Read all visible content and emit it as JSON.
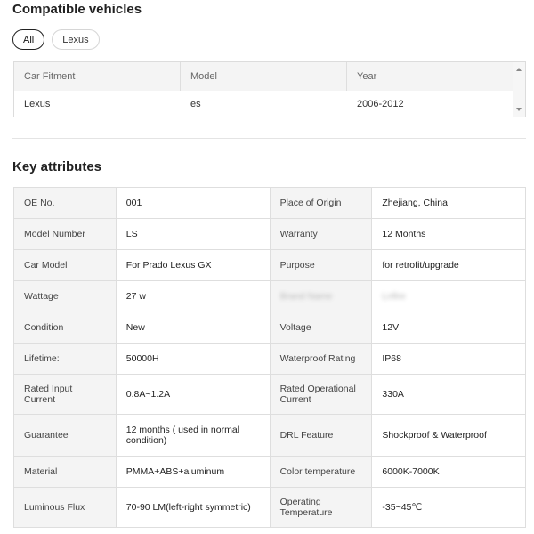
{
  "compatible": {
    "title": "Compatible vehicles",
    "chips": [
      "All",
      "Lexus"
    ],
    "headers": [
      "Car Fitment",
      "Model",
      "Year"
    ],
    "rows": [
      [
        "Lexus",
        "es",
        "2006-2012"
      ]
    ]
  },
  "attributes": {
    "title": "Key attributes",
    "rows": [
      {
        "k1": "OE No.",
        "v1": "001",
        "k2": "Place of Origin",
        "v2": "Zhejiang, China"
      },
      {
        "k1": "Model Number",
        "v1": "LS",
        "k2": "Warranty",
        "v2": "12 Months"
      },
      {
        "k1": "Car Model",
        "v1": "For Prado Lexus GX",
        "k2": "Purpose",
        "v2": "for retrofit/upgrade"
      },
      {
        "k1": "Wattage",
        "v1": "27 w",
        "k2": "Brand Name",
        "v2": "Lnfire"
      },
      {
        "k1": "Condition",
        "v1": "New",
        "k2": "Voltage",
        "v2": "12V"
      },
      {
        "k1": "Lifetime:",
        "v1": "50000H",
        "k2": "Waterproof Rating",
        "v2": "IP68"
      },
      {
        "k1": "Rated Input Current",
        "v1": "0.8A~1.2A",
        "k2": "Rated Operational Current",
        "v2": "330A"
      },
      {
        "k1": "Guarantee",
        "v1": "12 months ( used in normal condition)",
        "k2": "DRL Feature",
        "v2": "Shockproof & Waterproof"
      },
      {
        "k1": "Material",
        "v1": "PMMA+ABS+aluminum",
        "k2": "Color temperature",
        "v2": "6000K-7000K"
      },
      {
        "k1": "Luminous Flux",
        "v1": "70-90 LM(left-right symmetric)",
        "k2": "Operating Temperature",
        "v2": "-35~45℃"
      }
    ]
  }
}
